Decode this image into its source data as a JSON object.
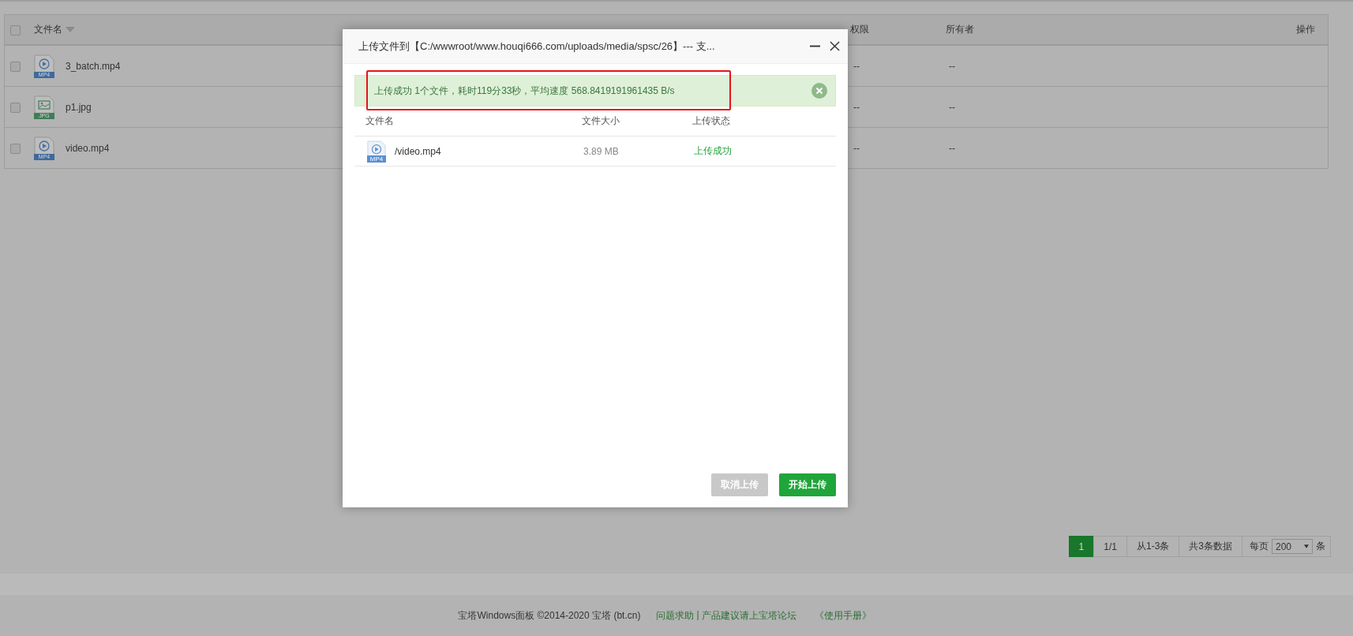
{
  "file_table": {
    "columns": [
      {
        "label": "文件名"
      },
      {
        "label": "权限"
      },
      {
        "label": "所有者"
      },
      {
        "label": "操作"
      }
    ],
    "header_checked": false,
    "rows": [
      {
        "name": "3_batch.mp4",
        "kind": "video",
        "badge": "MP4",
        "checked": false,
        "permission": "--",
        "owner": "--"
      },
      {
        "name": "p1.jpg",
        "kind": "image",
        "badge": "JPG",
        "checked": false,
        "permission": "--",
        "owner": "--"
      },
      {
        "name": "video.mp4",
        "kind": "video",
        "badge": "MP4",
        "checked": false,
        "permission": "--",
        "owner": "--"
      }
    ]
  },
  "pagination": {
    "pages": [
      {
        "label": "1",
        "selected": true
      }
    ],
    "page_of": "1/1",
    "range": "从1-3条",
    "total": "共3条数据",
    "per_page_label": "每页",
    "per_page": "200",
    "per_page_unit": "条"
  },
  "footer": {
    "copyright": "宝塔Windows面板 ©2014-2020 宝塔 (bt.cn)",
    "links": [
      {
        "label": "问题求助"
      },
      {
        "label": "产品建议请上宝塔论坛"
      },
      {
        "label": "《使用手册》"
      }
    ],
    "separator": "|"
  },
  "dialog": {
    "title": "上传文件到【C:/wwwroot/www.houqi666.com/uploads/media/spsc/26】--- 支...",
    "alert": {
      "text": "上传成功 1个文件，耗时119分33秒，平均速度 568.8419191961435 B/s",
      "highlighted": true
    },
    "columns": [
      "文件名",
      "文件大小",
      "上传状态"
    ],
    "files": [
      {
        "name": "/video.mp4",
        "badge": "MP4",
        "size": "3.89 MB",
        "status": "上传成功"
      }
    ],
    "buttons": [
      {
        "label": "取消上传",
        "disabled": true
      },
      {
        "label": "开始上传",
        "disabled": false
      }
    ]
  }
}
